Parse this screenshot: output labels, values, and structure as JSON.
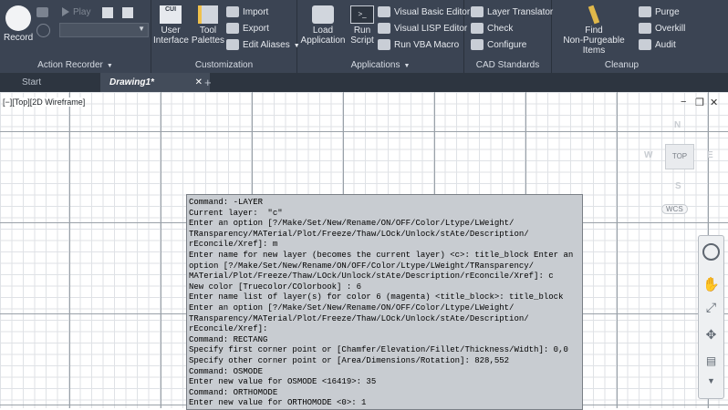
{
  "ribbon": {
    "action_recorder": {
      "title": "Action Recorder",
      "record_label": "Record",
      "play_label": "Play"
    },
    "customization": {
      "title": "Customization",
      "user_interface_label_1": "User",
      "user_interface_label_2": "Interface",
      "cui_badge": "CUI",
      "tool_palettes_label_1": "Tool",
      "tool_palettes_label_2": "Palettes",
      "import_label": "Import",
      "export_label": "Export",
      "edit_aliases_label": "Edit Aliases"
    },
    "applications": {
      "title": "Applications",
      "load_application_label_1": "Load",
      "load_application_label_2": "Application",
      "run_script_label_1": "Run",
      "run_script_label_2": "Script",
      "vbe_label": "Visual Basic Editor",
      "vlisp_label": "Visual LISP Editor",
      "run_vba_label": "Run VBA Macro"
    },
    "cad_standards": {
      "title": "CAD Standards",
      "layer_translator_label": "Layer Translator",
      "check_label": "Check",
      "configure_label": "Configure"
    },
    "cleanup": {
      "title": "Cleanup",
      "find_label_1": "Find",
      "find_label_2": "Non-Purgeable Items",
      "purge_label": "Purge",
      "overkill_label": "Overkill",
      "audit_label": "Audit"
    }
  },
  "tabs": [
    {
      "label": "Start"
    },
    {
      "label": "Drawing1*"
    }
  ],
  "viewport": {
    "label": "[−][Top][2D Wireframe]"
  },
  "viewcube": {
    "north": "N",
    "west": "W",
    "east": "E",
    "south": "S",
    "top": "TOP",
    "wcs": "WCS"
  },
  "command_history": [
    "Command: -LAYER",
    "Current layer:  \"c\"",
    "Enter an option [?/Make/Set/New/Rename/ON/OFF/Color/Ltype/LWeight/",
    "TRansparency/MATerial/Plot/Freeze/Thaw/LOck/Unlock/stAte/Description/",
    "rEconcile/Xref]: m",
    "Enter name for new layer (becomes the current layer) <c>: title_block Enter an",
    "option [?/Make/Set/New/Rename/ON/OFF/Color/Ltype/LWeight/TRansparency/",
    "MATerial/Plot/Freeze/Thaw/LOck/Unlock/stAte/Description/rEconcile/Xref]: c",
    "New color [Truecolor/COlorbook] : 6",
    "Enter name list of layer(s) for color 6 (magenta) <title_block>: title_block",
    "Enter an option [?/Make/Set/New/Rename/ON/OFF/Color/Ltype/LWeight/",
    "TRansparency/MATerial/Plot/Freeze/Thaw/LOck/Unlock/stAte/Description/",
    "rEconcile/Xref]:",
    "Command: RECTANG",
    "Specify first corner point or [Chamfer/Elevation/Fillet/Thickness/Width]: 0,0",
    "Specify other corner point or [Area/Dimensions/Rotation]: 828,552",
    "Command: OSMODE",
    "Enter new value for OSMODE <16419>: 35",
    "Command: ORTHOMODE",
    "Enter new value for ORTHOMODE <0>: 1"
  ],
  "colors": {
    "ribbon_bg": "#3b4453",
    "tabbar_bg": "#2d3540",
    "command_bg": "#c8ccd1"
  }
}
